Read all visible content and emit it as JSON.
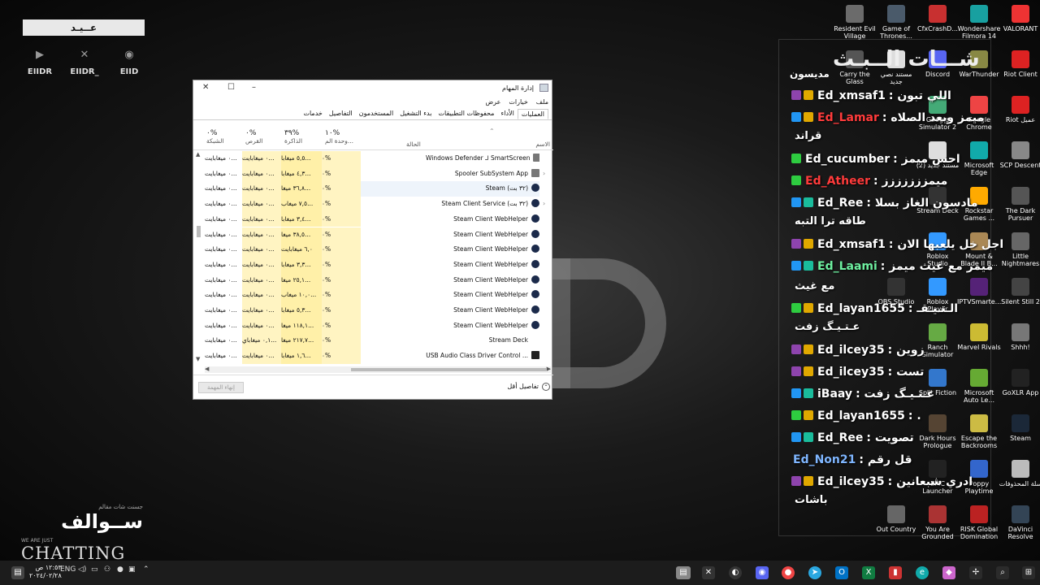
{
  "brand": {
    "top": "عــيـد",
    "socials": [
      {
        "icon": "youtube-icon",
        "label": "EIIDR"
      },
      {
        "icon": "x-icon",
        "label": "EIIDR_"
      },
      {
        "icon": "discord-icon",
        "label": "EIID"
      }
    ],
    "bottom_small": "جسنت شات مقالم",
    "bottom_ar": "ســوالف",
    "bottom_we": "WE ARE JUST",
    "bottom_chatting": "CHATTING"
  },
  "desktop_icons": [
    {
      "label": "Resident Evil Village",
      "color": "#6b6b6b"
    },
    {
      "label": "Game of Thrones...",
      "color": "#4a5a6a"
    },
    {
      "label": "CfxCrashD...",
      "color": "#c83030"
    },
    {
      "label": "Wondershare Filmora 14",
      "color": "#18a0a0"
    },
    {
      "label": "VALORANT",
      "color": "#e33"
    },
    {
      "label": "Carry the Glass",
      "color": "#555"
    },
    {
      "label": "مستند نصي جديد",
      "color": "#ddd"
    },
    {
      "label": "Discord",
      "color": "#5865f2"
    },
    {
      "label": "WarThunder",
      "color": "#884"
    },
    {
      "label": "Riot Client",
      "color": "#d22"
    },
    {
      "label": "Google Simulator 2",
      "color": "#4a7"
    },
    {
      "label": "Google Chrome",
      "color": "#e44"
    },
    {
      "label": "Riot عميل",
      "color": "#d22"
    },
    {
      "label": "Microsoft Edge",
      "color": "#1aa"
    },
    {
      "label": "SCP Descent",
      "color": "#888"
    },
    {
      "label": "مستند جديد (2)",
      "color": "#ddd"
    },
    {
      "label": "Stream Deck",
      "color": "#333"
    },
    {
      "label": "Rockstar Games ...",
      "color": "#fa0"
    },
    {
      "label": "The Dark Pursuer",
      "color": "#555"
    },
    {
      "label": "Roblox Studio",
      "color": "#39f"
    },
    {
      "label": "Mount & Blade II B...",
      "color": "#a85"
    },
    {
      "label": "Little Nightmares",
      "color": "#666"
    },
    {
      "label": "OBS Studio",
      "color": "#333"
    },
    {
      "label": "Roblox Player",
      "color": "#39f"
    },
    {
      "label": "IPTVSmarte...",
      "color": "#527"
    },
    {
      "label": "Silent Still 2",
      "color": "#444"
    },
    {
      "label": "Ranch Simulator",
      "color": "#6a4"
    },
    {
      "label": "Marvel Rivals",
      "color": "#cb3"
    },
    {
      "label": "Shhh!",
      "color": "#777"
    },
    {
      "label": "Split Fiction",
      "color": "#37c"
    },
    {
      "label": "Microsoft Auto Le...",
      "color": "#6a3"
    },
    {
      "label": "GoXLR App",
      "color": "#222"
    },
    {
      "label": "Dark Hours Prologue",
      "color": "#543"
    },
    {
      "label": "Escape the Backrooms",
      "color": "#cb4"
    },
    {
      "label": "Steam",
      "color": "#1b2838"
    },
    {
      "label": "EPIC Launcher",
      "color": "#222"
    },
    {
      "label": "Poppy Playtime",
      "color": "#36c"
    },
    {
      "label": "سلة المحذوفات",
      "color": "#bbb"
    },
    {
      "label": "Out Country",
      "color": "#666"
    },
    {
      "label": "You Are Grounded",
      "color": "#a33"
    },
    {
      "label": "RISK Global Domination",
      "color": "#b22"
    },
    {
      "label": "DaVinci Resolve",
      "color": "#345"
    }
  ],
  "chat": {
    "title": "شـــات الــبـث",
    "first": "مديسون",
    "messages": [
      {
        "badge": "#8e44ad",
        "badge2": "#e0a800",
        "name": "Ed_xmsaf1",
        "color": "#ffffff",
        "text": ": اللي تبون"
      },
      {
        "badge": "#2196f3",
        "badge2": "#e0a800",
        "name": "Ed_Lamar",
        "color": "#ff3b3b",
        "text": ": ميمز وبعد الصلاه"
      },
      {
        "text": "قراند"
      },
      {
        "badge": "#2ecc40",
        "name": "Ed_cucumber",
        "color": "#ffffff",
        "text": ": احس ميمز"
      },
      {
        "badge": "#2ecc40",
        "name": "Ed_Atheer",
        "color": "#ff3b3b",
        "text": ": ميمززززززز"
      },
      {
        "badge": "#2196f3",
        "badge2": "#1abc9c",
        "name": "Ed_Ree",
        "color": "#ffffff",
        "text": ": مادسون الغاز بسلا"
      },
      {
        "text": "طاقه ترا التبه"
      },
      {
        "badge": "#8e44ad",
        "badge2": "#e0a800",
        "name": "Ed_xmsaf1",
        "color": "#ffffff",
        "text": ": اجل خل يلعبها الان"
      },
      {
        "badge": "#2196f3",
        "badge2": "#1abc9c",
        "name": "Ed_Laami",
        "color": "#6ef0a0",
        "text": ": ميمز مع غيث ميمز"
      },
      {
        "text": "مع غيث"
      },
      {
        "badge": "#2ecc40",
        "badge2": "#e0a800",
        "name": "Ed_layan1655",
        "color": "#ffffff",
        "text": ": الـتـيـقـ"
      },
      {
        "text": "عـتـيـگ زفت"
      },
      {
        "badge": "#8e44ad",
        "badge2": "#e0a800",
        "name": "Ed_ilcey35",
        "color": "#ffffff",
        "text": ": زوين"
      },
      {
        "badge": "#8e44ad",
        "badge2": "#e0a800",
        "name": "Ed_ilcey35",
        "color": "#ffffff",
        "text": ": تست"
      },
      {
        "badge": "#2196f3",
        "badge2": "#1abc9c",
        "name": "iBaay",
        "color": "#ffffff",
        "text": ": عـتـيـگ زفت"
      },
      {
        "badge": "#2ecc40",
        "badge2": "#e0a800",
        "name": "Ed_layan1655",
        "color": "#ffffff",
        "text": ": ."
      },
      {
        "badge": "#2196f3",
        "badge2": "#1abc9c",
        "name": "Ed_Ree",
        "color": "#ffffff",
        "text": ": تصويت"
      },
      {
        "name": "Ed_Non21",
        "color": "#7fb6ff",
        "text": ": قل رقم"
      },
      {
        "badge": "#8e44ad",
        "badge2": "#e0a800",
        "name": "Ed_ilcey35",
        "color": "#ffffff",
        "text": ": ادري شبعانين"
      },
      {
        "text": "باشات"
      }
    ]
  },
  "task_manager": {
    "title": "إدارة المهام",
    "window_buttons": {
      "close": "✕",
      "max": "☐",
      "min": "–"
    },
    "menu": [
      "ملف",
      "خيارات",
      "عرض"
    ],
    "tabs": [
      "العمليات",
      "الأداء",
      "محفوظات التطبيقات",
      "بدء التشغيل",
      "المستخدمون",
      "التفاصيل",
      "خدمات"
    ],
    "active_tab": "العمليات",
    "columns": {
      "name": "الاسم",
      "status": "الحالة",
      "cpu_pct": "١٠%",
      "cpu": "وحدة الم...",
      "mem_pct": "٣٩%",
      "mem": "الذاكرة",
      "disk_pct": "٠%",
      "disk": "القرص",
      "net_pct": "٠%",
      "net": "الشبكة"
    },
    "rows": [
      {
        "icon": "shield-icon",
        "name": "Windows Defender لـ SmartScreen",
        "cpu": "٠%",
        "mem": "٥,٥ ميغابا...",
        "disk": "٠ ميغابايت...",
        "net": "٠ ميغابايت..."
      },
      {
        "icon": "printer-icon",
        "name": "Spooler SubSystem App",
        "cpu": "٠%",
        "mem": "٤,٣ ميغابا...",
        "disk": "٠ ميغابايت...",
        "net": "٠ ميغابايت..."
      },
      {
        "icon": "steam-icon",
        "name": "Steam (٣٢ بت)",
        "cpu": "٠%",
        "mem": "٣٦,٨ ميغا...",
        "disk": "٠ ميغابايت...",
        "net": "٠ ميغابايت...",
        "selected": true
      },
      {
        "icon": "steam-icon",
        "name": "Steam Client Service (٣٢ بت)",
        "cpu": "٠%",
        "mem": "٧,٥ ميغاب...",
        "disk": "٠ ميغابايت...",
        "net": "٠ ميغابايت..."
      },
      {
        "icon": "steam-icon",
        "name": "Steam Client WebHelper",
        "cpu": "٠%",
        "mem": "٣,٤ ميغابا...",
        "disk": "٠ ميغابايت...",
        "net": "٠ ميغابايت..."
      },
      {
        "icon": "steam-icon",
        "name": "Steam Client WebHelper",
        "cpu": "٠%",
        "mem": "٣٨,٥ ميغا...",
        "disk": "٠ ميغابايت...",
        "net": "٠ ميغابايت..."
      },
      {
        "icon": "steam-icon",
        "name": "Steam Client WebHelper",
        "cpu": "٠%",
        "mem": "٦,٠ ميغابايت",
        "disk": "٠ ميغابايت...",
        "net": "٠ ميغابايت..."
      },
      {
        "icon": "steam-icon",
        "name": "Steam Client WebHelper",
        "cpu": "٠%",
        "mem": "٣,٣ ميغابا...",
        "disk": "٠ ميغابايت...",
        "net": "٠ ميغابايت..."
      },
      {
        "icon": "steam-icon",
        "name": "Steam Client WebHelper",
        "cpu": "٠%",
        "mem": "٢٥,١ ميغا...",
        "disk": "٠ ميغابايت...",
        "net": "٠ ميغابايت..."
      },
      {
        "icon": "steam-icon",
        "name": "Steam Client WebHelper",
        "cpu": "٠%",
        "mem": "١٠,٠ ميغاب...",
        "disk": "٠ ميغابايت...",
        "net": "٠ ميغابايت..."
      },
      {
        "icon": "steam-icon",
        "name": "Steam Client WebHelper",
        "cpu": "٠%",
        "mem": "٥,٣ ميغابا...",
        "disk": "٠ ميغابايت...",
        "net": "٠ ميغابايت..."
      },
      {
        "icon": "steam-icon",
        "name": "Steam Client WebHelper",
        "cpu": "٠%",
        "mem": "١١٨,١ ميغا...",
        "disk": "٠ ميغابايت...",
        "net": "٠ ميغابايت..."
      },
      {
        "icon": "none",
        "name": "Stream Deck",
        "cpu": "٠%",
        "mem": "٢١٧,٧ ميغا...",
        "disk": "٠,١ ميغاباي...",
        "net": "٠ ميغابايت..."
      },
      {
        "icon": "usb-icon",
        "name": "USB Audio Class Driver Control ...",
        "cpu": "٠%",
        "mem": "١,٦ ميغابا...",
        "disk": "٠ ميغابايت...",
        "net": "٠ ميغابايت..."
      }
    ],
    "end_task": "إنهاء المهمة",
    "fewer_details": "تفاصيل أقل"
  },
  "taskbar": {
    "lang": "ENG",
    "time": "١٢:٥٣ ص",
    "date": "٢٠٢٤/٠٢/٢٨"
  }
}
